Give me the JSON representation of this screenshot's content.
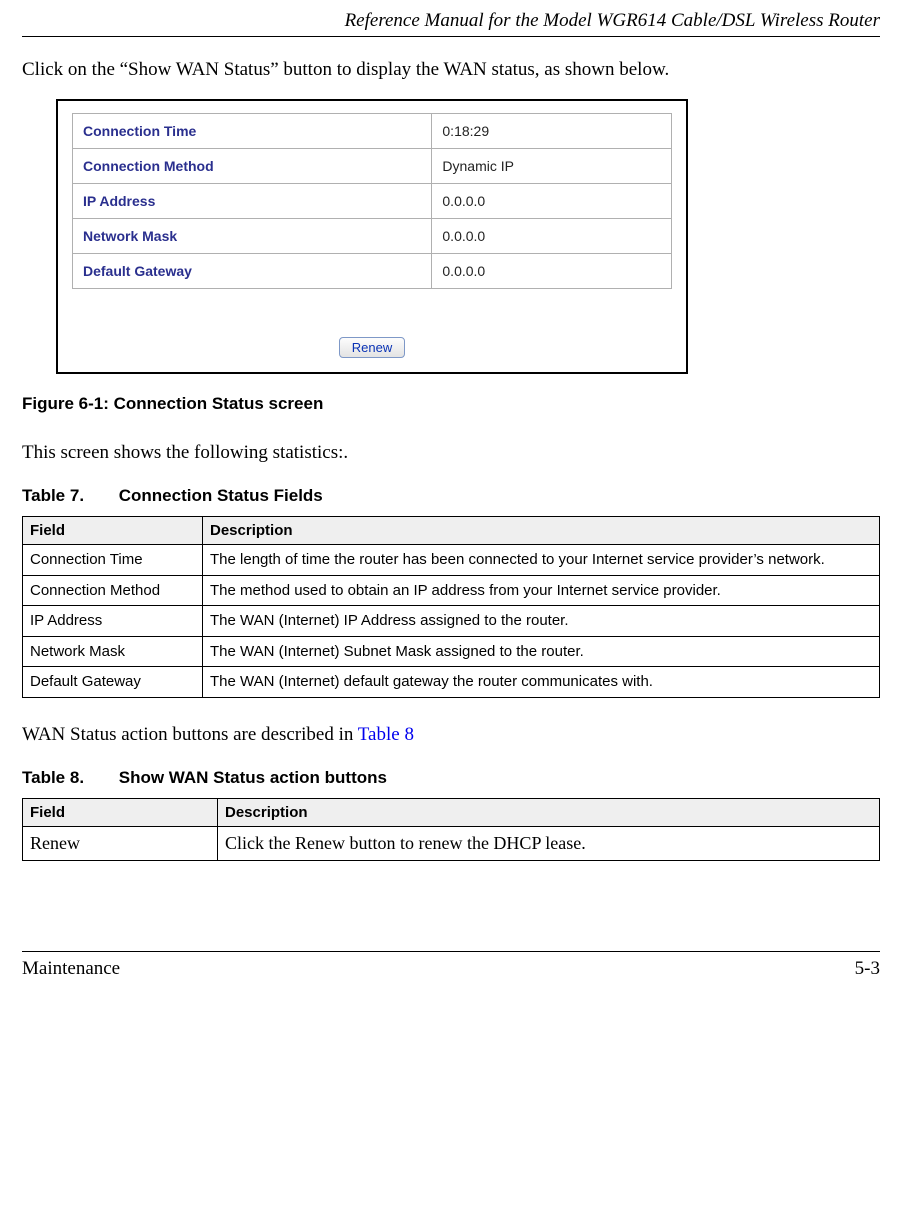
{
  "header": {
    "title": "Reference Manual for the Model WGR614 Cable/DSL Wireless Router"
  },
  "intro_text": "Click on the “Show WAN Status” button to display the WAN status, as shown below.",
  "screenshot": {
    "rows": [
      {
        "label": "Connection Time",
        "value": "0:18:29"
      },
      {
        "label": "Connection Method",
        "value": "Dynamic IP"
      },
      {
        "label": "IP Address",
        "value": "0.0.0.0"
      },
      {
        "label": "Network Mask",
        "value": "0.0.0.0"
      },
      {
        "label": "Default Gateway",
        "value": "0.0.0.0"
      }
    ],
    "button_label": "Renew"
  },
  "figure_caption": "Figure 6-1: Connection Status screen",
  "stats_text": "This screen shows the following statistics:.",
  "table7": {
    "caption_num": "Table 7.",
    "caption_title": "Connection Status Fields",
    "head_field": "Field",
    "head_desc": "Description",
    "rows": [
      {
        "field": "Connection Time",
        "desc": "The length of time the router has been connected to your Internet service provider’s network."
      },
      {
        "field": "Connection Method",
        "desc": "The method used to obtain an IP address from your Internet service provider."
      },
      {
        "field": "IP Address",
        "desc": "The WAN (Internet) IP Address assigned to the router."
      },
      {
        "field": "Network Mask",
        "desc": "The WAN (Internet) Subnet Mask assigned to the router."
      },
      {
        "field": "Default Gateway",
        "desc": "The WAN (Internet) default gateway the router communicates with."
      }
    ]
  },
  "wan_text_pre": "WAN Status action buttons are described in ",
  "wan_text_link": "Table 8",
  "table8": {
    "caption_num": "Table 8.",
    "caption_title": "Show WAN Status action buttons",
    "head_field": "Field",
    "head_desc": "Description",
    "rows": [
      {
        "field": "Renew",
        "desc": "Click the Renew button to renew the DHCP lease."
      }
    ]
  },
  "footer": {
    "left": "Maintenance",
    "right": "5-3"
  }
}
